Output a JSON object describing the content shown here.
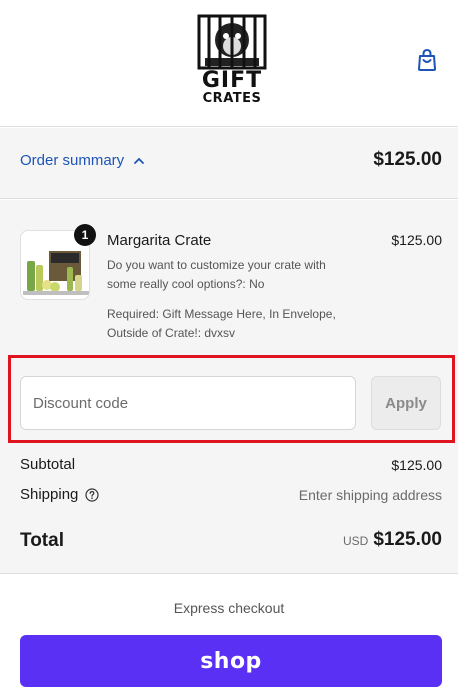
{
  "header": {
    "logo_text_top": "GIFT",
    "logo_text_bottom": "CRATES",
    "cart_icon": "shopping-bag-icon"
  },
  "summary": {
    "toggle_label": "Order summary",
    "total": "$125.00"
  },
  "line_items": [
    {
      "name": "Margarita Crate",
      "price": "$125.00",
      "quantity": "1",
      "option_1": "Do you want to customize your crate with some really cool options?: No",
      "option_2": "Required: Gift Message Here, In Envelope, Outside of Crate!: dvxsv"
    }
  ],
  "discount": {
    "placeholder": "Discount code",
    "value": "",
    "apply_label": "Apply"
  },
  "totals": {
    "subtotal_label": "Subtotal",
    "subtotal_value": "$125.00",
    "shipping_label": "Shipping",
    "shipping_value": "Enter shipping address",
    "total_label": "Total",
    "currency": "USD",
    "total_value": "$125.00"
  },
  "express": {
    "label": "Express checkout",
    "shop_button": "shop"
  },
  "colors": {
    "link_blue": "#1e54b7",
    "shop_purple": "#5a31f4",
    "highlight_red": "#e0141e"
  }
}
